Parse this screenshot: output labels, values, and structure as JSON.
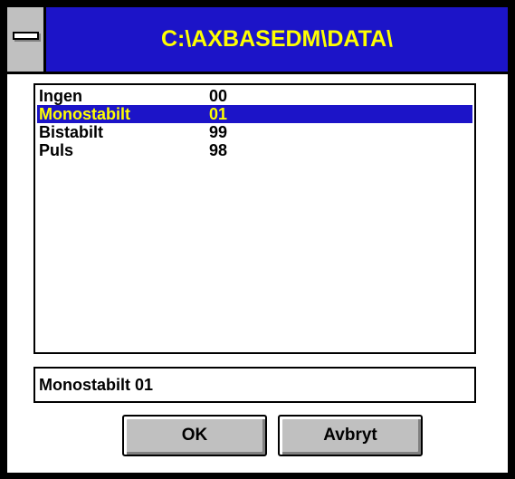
{
  "window": {
    "title": "C:\\AXBASEDM\\DATA\\"
  },
  "listbox": {
    "items": [
      {
        "name": "Ingen",
        "code": "00",
        "selected": false
      },
      {
        "name": "Monostabilt",
        "code": "01",
        "selected": true
      },
      {
        "name": "Bistabilt",
        "code": "99",
        "selected": false
      },
      {
        "name": "Puls",
        "code": "98",
        "selected": false
      }
    ]
  },
  "selection_field": {
    "value": "Monostabilt 01"
  },
  "buttons": {
    "ok_label": "OK",
    "cancel_label": "Avbryt"
  },
  "colors": {
    "title_bar": "#1c14c8",
    "title_text": "#ffff00",
    "selection_bg": "#1c14c8",
    "selection_text": "#ffff00",
    "button_face": "#c0c0c0"
  }
}
